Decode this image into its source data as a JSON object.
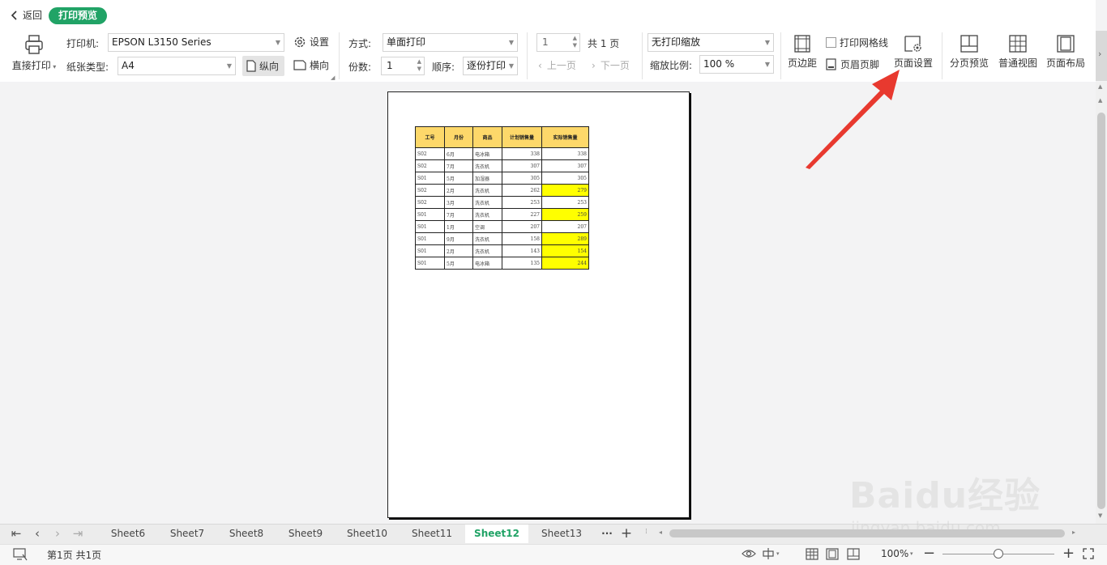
{
  "header": {
    "back_label": "返回",
    "mode_badge": "打印预览"
  },
  "printer": {
    "direct_print_label": "直接打印",
    "printer_label": "打印机:",
    "printer_value": "EPSON L3150 Series",
    "settings_label": "设置",
    "paper_label": "纸张类型:",
    "paper_value": "A4",
    "portrait_label": "纵向",
    "landscape_label": "横向"
  },
  "mode": {
    "method_label": "方式:",
    "method_value": "单面打印",
    "copies_label": "份数:",
    "copies_value": "1",
    "order_label": "顺序:",
    "order_value": "逐份打印"
  },
  "paging": {
    "page_input": "1",
    "total_label": "共 1 页",
    "prev_label": "上一页",
    "next_label": "下一页"
  },
  "scaling": {
    "scale_mode": "无打印缩放",
    "ratio_label": "缩放比例:",
    "ratio_value": "100 %"
  },
  "layout_tools": {
    "margins_label": "页边距",
    "gridlines_label": "打印网格线",
    "gridlines_checked": false,
    "header_footer_label": "页眉页脚",
    "page_setup_label": "页面设置",
    "page_break_label": "分页预览",
    "normal_view_label": "普通视图",
    "page_layout_label": "页面布局"
  },
  "spreadsheet": {
    "headers": [
      "工号",
      "月份",
      "商品",
      "计划销售量",
      "实际销售量"
    ],
    "rows": [
      [
        "S02",
        "6月",
        "电冰箱",
        "338",
        "338"
      ],
      [
        "S02",
        "7月",
        "洗衣机",
        "307",
        "307"
      ],
      [
        "S01",
        "5月",
        "加湿器",
        "305",
        "305"
      ],
      [
        "S02",
        "2月",
        "洗衣机",
        "262",
        "279"
      ],
      [
        "S02",
        "3月",
        "洗衣机",
        "253",
        "253"
      ],
      [
        "S01",
        "7月",
        "洗衣机",
        "227",
        "259"
      ],
      [
        "S01",
        "1月",
        "空调",
        "207",
        "207"
      ],
      [
        "S01",
        "9月",
        "洗衣机",
        "158",
        "289"
      ],
      [
        "S01",
        "2月",
        "洗衣机",
        "143",
        "154"
      ],
      [
        "S01",
        "5月",
        "电冰箱",
        "135",
        "244"
      ]
    ],
    "highlighted_rows": [
      3,
      5,
      7,
      8,
      9
    ],
    "highlight_color": "#ffff00",
    "header_color": "#fdd86a"
  },
  "sheet_tabs": {
    "tabs": [
      "Sheet6",
      "Sheet7",
      "Sheet8",
      "Sheet9",
      "Sheet10",
      "Sheet11",
      "Sheet12",
      "Sheet13"
    ],
    "active": "Sheet12",
    "more_label": "···",
    "add_label": "+"
  },
  "statusbar": {
    "page_info": "第1页 共1页",
    "zoom": "100%"
  },
  "watermark": {
    "brand": "Baidu经验",
    "url": "jingyan.baidu.com"
  },
  "colors": {
    "accent": "#21a366",
    "annotation_arrow": "#e8392f"
  }
}
